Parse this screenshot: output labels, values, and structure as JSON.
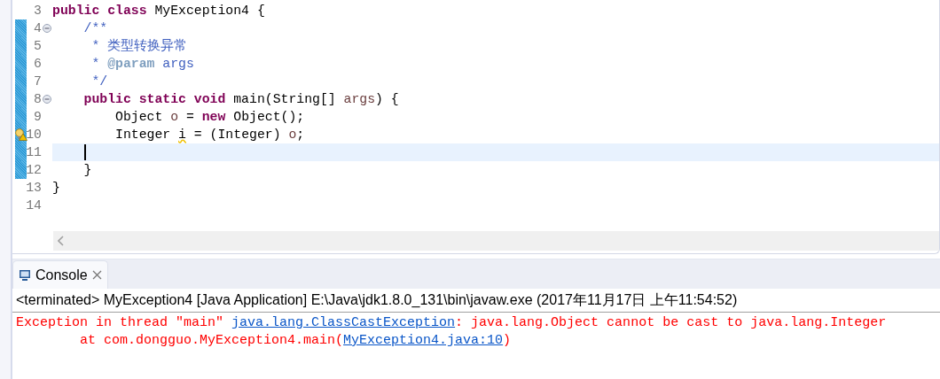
{
  "editor": {
    "lines": [
      {
        "number": "3",
        "changed": false,
        "fold": false,
        "warning": false,
        "current": false,
        "tokens": [
          {
            "kind": "keyword",
            "text": "public class"
          },
          {
            "kind": "plain",
            "text": " MyException4 {"
          }
        ]
      },
      {
        "number": "4",
        "changed": true,
        "fold": true,
        "warning": false,
        "current": false,
        "tokens": [
          {
            "kind": "javadoc",
            "text": "    /**"
          }
        ]
      },
      {
        "number": "5",
        "changed": true,
        "fold": false,
        "warning": false,
        "current": false,
        "tokens": [
          {
            "kind": "javadoc",
            "text": "     * 类型转换异常"
          }
        ]
      },
      {
        "number": "6",
        "changed": true,
        "fold": false,
        "warning": false,
        "current": false,
        "tokens": [
          {
            "kind": "javadoc",
            "text": "     * "
          },
          {
            "kind": "tag",
            "text": "@param"
          },
          {
            "kind": "javadoc",
            "text": " args"
          }
        ]
      },
      {
        "number": "7",
        "changed": true,
        "fold": false,
        "warning": false,
        "current": false,
        "tokens": [
          {
            "kind": "javadoc",
            "text": "     */"
          }
        ]
      },
      {
        "number": "8",
        "changed": true,
        "fold": true,
        "warning": false,
        "current": false,
        "tokens": [
          {
            "kind": "keyword",
            "text": "    public static void"
          },
          {
            "kind": "plain",
            "text": " main(String[] "
          },
          {
            "kind": "variable",
            "text": "args"
          },
          {
            "kind": "plain",
            "text": ") {"
          }
        ]
      },
      {
        "number": "9",
        "changed": true,
        "fold": false,
        "warning": false,
        "current": false,
        "tokens": [
          {
            "kind": "plain",
            "text": "        Object "
          },
          {
            "kind": "variable",
            "text": "o"
          },
          {
            "kind": "plain",
            "text": " = "
          },
          {
            "kind": "keyword",
            "text": "new"
          },
          {
            "kind": "plain",
            "text": " Object();"
          }
        ]
      },
      {
        "number": "10",
        "changed": true,
        "fold": false,
        "warning": true,
        "current": false,
        "tokens": [
          {
            "kind": "plain",
            "text": "        Integer "
          },
          {
            "kind": "warned",
            "text": "i"
          },
          {
            "kind": "plain",
            "text": " = (Integer) "
          },
          {
            "kind": "variable",
            "text": "o"
          },
          {
            "kind": "plain",
            "text": ";"
          }
        ]
      },
      {
        "number": "11",
        "changed": true,
        "fold": false,
        "warning": false,
        "current": true
      },
      {
        "number": "12",
        "changed": true,
        "fold": false,
        "warning": false,
        "current": false,
        "tokens": [
          {
            "kind": "plain",
            "text": "    }"
          }
        ]
      },
      {
        "number": "13",
        "changed": false,
        "fold": false,
        "warning": false,
        "current": false,
        "tokens": [
          {
            "kind": "plain",
            "text": "}"
          }
        ]
      },
      {
        "number": "14",
        "changed": false,
        "fold": false,
        "warning": false,
        "current": false
      }
    ]
  },
  "console": {
    "tab": {
      "label": "Console",
      "selected": true
    },
    "header": "<terminated> MyException4 [Java Application] E:\\Java\\jdk1.8.0_131\\bin\\javaw.exe (2017年11月17日 上午11:54:52)",
    "output": [
      [
        {
          "kind": "error",
          "text": "Exception in thread \"main\" "
        },
        {
          "kind": "link",
          "text": "java.lang.ClassCastException"
        },
        {
          "kind": "error",
          "text": ": java.lang.Object cannot be cast to java.lang.Integer"
        }
      ],
      [
        {
          "kind": "error",
          "text": "\tat com.dongguo.MyException4.main("
        },
        {
          "kind": "link",
          "text": "MyException4.java:10"
        },
        {
          "kind": "error",
          "text": ")"
        }
      ]
    ]
  }
}
